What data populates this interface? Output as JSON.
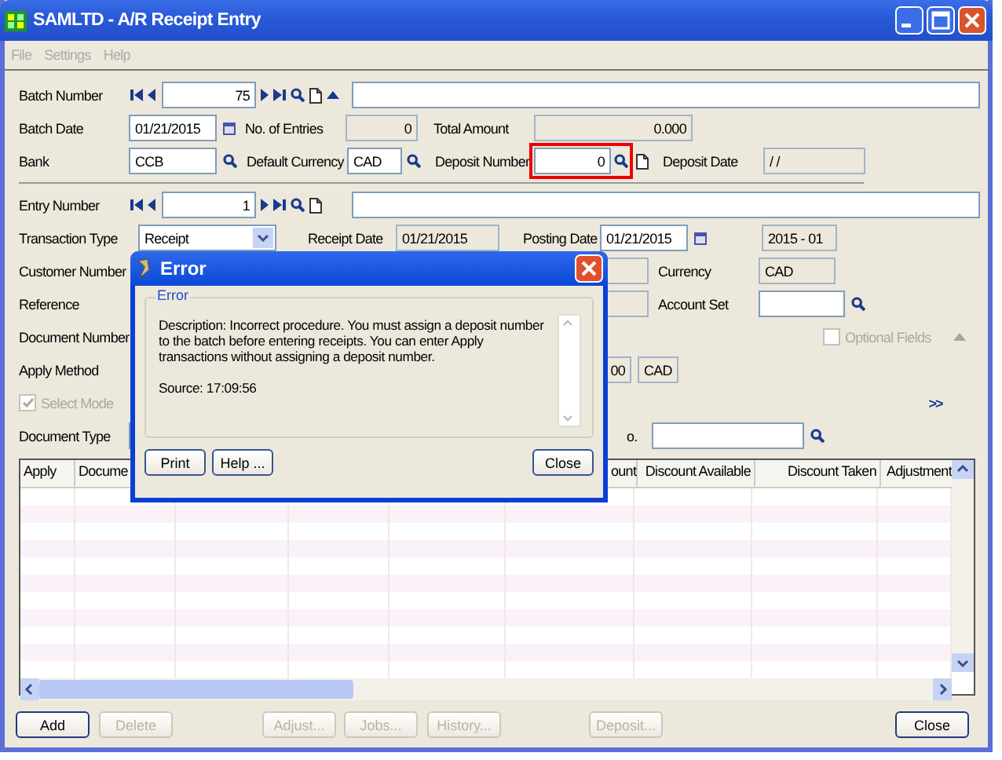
{
  "window": {
    "title": "SAMLTD - A/R Receipt Entry"
  },
  "menu": [
    {
      "label": "File"
    },
    {
      "label": "Settings"
    },
    {
      "label": "Help"
    }
  ],
  "batch": {
    "number_label": "Batch Number",
    "number": "75",
    "date_label": "Batch Date",
    "date": "01/21/2015",
    "entries_label": "No. of Entries",
    "entries": "0",
    "total_label": "Total Amount",
    "total": "0.000",
    "bank_label": "Bank",
    "bank": "CCB",
    "currency_label": "Default Currency",
    "currency": "CAD",
    "deposit_label": "Deposit Number",
    "deposit": "0",
    "deposit_highlighted": true,
    "deposit_date_label": "Deposit Date",
    "deposit_date": "/  /"
  },
  "entry": {
    "number_label": "Entry Number",
    "number": "1",
    "type_label": "Transaction Type",
    "type": "Receipt",
    "receipt_date_label": "Receipt Date",
    "receipt_date": "01/21/2015",
    "posting_date_label": "Posting Date",
    "posting_date": "01/21/2015",
    "period": "2015 - 01",
    "customer_label": "Customer Number",
    "currency_label": "Currency",
    "currency": "CAD",
    "reference_label": "Reference",
    "account_set_label": "Account Set",
    "document_label": "Document Number",
    "optional_fields_label": "Optional Fields",
    "optional_fields_checked": false,
    "apply_label": "Apply Method",
    "amount_partial": "00",
    "amount_currency": "CAD",
    "select_mode_label": "Select Mode",
    "select_mode_checked": true,
    "document_type_label": "Document Type",
    "partial_label": "o.",
    "expand": ">>"
  },
  "table": {
    "columns": [
      "Apply",
      "Docume",
      "ount",
      "Discount Available",
      "Discount Taken",
      "Adjustment"
    ]
  },
  "buttons": [
    {
      "label": "Add",
      "disabled": false
    },
    {
      "label": "Delete",
      "disabled": true
    },
    {
      "label": "Adjust...",
      "disabled": true
    },
    {
      "label": "Jobs...",
      "disabled": true
    },
    {
      "label": "History...",
      "disabled": true
    },
    {
      "label": "Deposit...",
      "disabled": true
    },
    {
      "label": "Close",
      "disabled": false
    }
  ],
  "dialog": {
    "title": "Error",
    "group_label": "Error",
    "message": "Description: Incorrect procedure. You must assign a deposit number to the batch before entering receipts. You can enter Apply transactions without assigning a deposit number.",
    "source": "Source:  17:09:56",
    "buttons": [
      {
        "label": "Print"
      },
      {
        "label": "Help ..."
      },
      {
        "label": "Close"
      }
    ]
  }
}
